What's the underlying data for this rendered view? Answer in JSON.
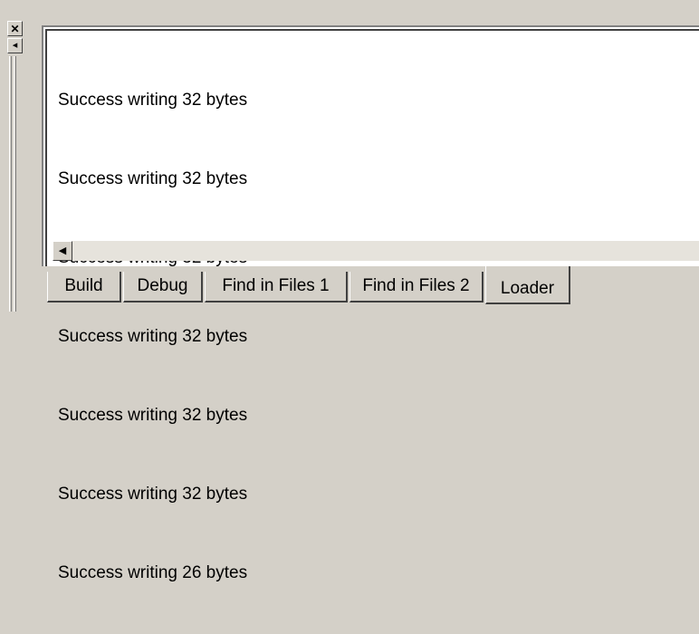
{
  "window": {
    "close_glyph": "✕",
    "restore_glyph": "◂"
  },
  "output": {
    "lines": [
      "Success writing 32 bytes",
      "Success writing 32 bytes",
      "Success writing 32 bytes",
      "Success writing 32 bytes",
      "Success writing 32 bytes",
      "Success writing 32 bytes",
      "Success writing 26 bytes"
    ]
  },
  "scrollbar": {
    "left_arrow": "◀"
  },
  "tabs": [
    {
      "label": "Build"
    },
    {
      "label": "Debug"
    },
    {
      "label": "Find in Files 1"
    },
    {
      "label": "Find in Files 2"
    },
    {
      "label": "Loader",
      "active": true
    }
  ]
}
